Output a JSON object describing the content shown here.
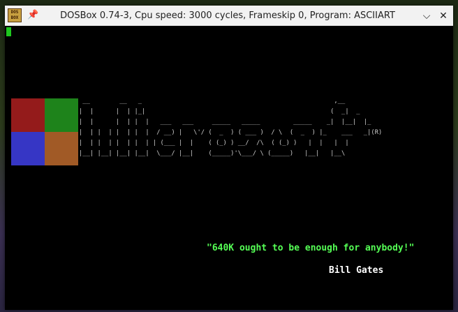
{
  "window": {
    "title": "DOSBox 0.74-3, Cpu speed: 3000 cycles, Frameskip 0, Program: ASCIIART",
    "icon_text": "DOS BOX",
    "pin_icon": "pin-icon",
    "minimize_icon": "chevron-down-icon",
    "close_icon": "close-icon"
  },
  "screen": {
    "cursor_color": "#1ec81e",
    "logo_colors": [
      "#a51e1e",
      "#22921e",
      "#3c3cdc",
      "#b4642a"
    ],
    "ascii_art": " __        __   _                                                    ,__\n|  |      |  | |_|                                                  (  _|  _\n|  |      |  | |  |   ___   ___     _____   _____         _____    _|  |__|  |_\n|  | |  | |  | |  |  / __) |   \\'/ (  _  ) ( ___ )  / \\  (  _  ) |_    ___   _|(R)\n|  | |  | |  | |  | | (___ |  |    ( (_) ) __/  /\\  ( (_) )   |  |   |  |\n|__| |__| |__| |__|  \\___/ |__|    (_____)'\\___/ \\ (_____)   |__|   |__\\",
    "quote": "\"640K ought to be enough for anybody!\"",
    "author": "Bill Gates",
    "quote_color": "#55ff55"
  }
}
